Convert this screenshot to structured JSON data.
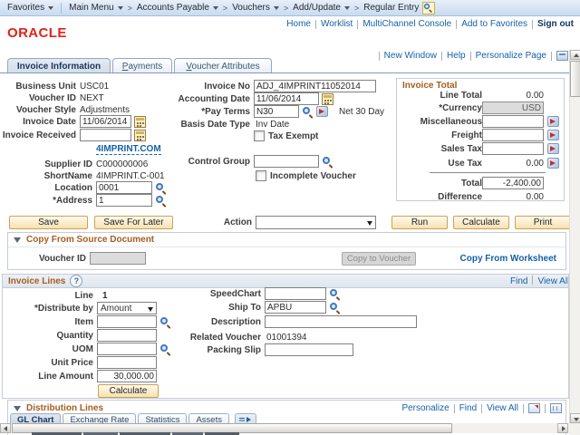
{
  "chrome": {
    "favorites": "Favorites",
    "main_menu": "Main Menu",
    "breadcrumbs": [
      "Accounts Payable",
      "Vouchers",
      "Add/Update",
      "Regular Entry"
    ],
    "nav_links": {
      "home": "Home",
      "worklist": "Worklist",
      "multichannel_console": "MultiChannel Console",
      "add_to_favorites": "Add to Favorites",
      "sign_out": "Sign out"
    },
    "logo": "ORACLE",
    "utility": {
      "new_window": "New Window",
      "help": "Help",
      "personalize_page": "Personalize Page"
    }
  },
  "page_tabs": {
    "invoice_information": "Invoice Information",
    "payments": "Payments",
    "voucher_attributes": "Voucher Attributes"
  },
  "header_fields": {
    "business_unit": {
      "label": "Business Unit",
      "value": "USC01"
    },
    "voucher_id": {
      "label": "Voucher ID",
      "value": "NEXT"
    },
    "voucher_style": {
      "label": "Voucher Style",
      "value": "Adjustments"
    },
    "invoice_date": {
      "label": "Invoice Date",
      "value": "11/06/2014"
    },
    "invoice_received": {
      "label": "Invoice Received",
      "value": ""
    },
    "supplier_site": "4IMPRINT.COM",
    "supplier_id": {
      "label": "Supplier ID",
      "value": "C000000006"
    },
    "short_name": {
      "label": "ShortName",
      "value": "4IMPRINT.C-001"
    },
    "location": {
      "label": "Location",
      "value": "0001"
    },
    "address": {
      "label": "*Address",
      "value": "1"
    },
    "invoice_no": {
      "label": "Invoice No",
      "value": "ADJ_4IMPRINT11052014"
    },
    "accounting_date": {
      "label": "Accounting Date",
      "value": "11/06/2014"
    },
    "pay_terms": {
      "label": "*Pay Terms",
      "value": "N30",
      "description": "Net 30 Day"
    },
    "basis_date_type": {
      "label": "Basis Date Type",
      "value": "Inv Date"
    },
    "tax_exempt_label": "Tax Exempt",
    "control_group": {
      "label": "Control Group",
      "value": ""
    },
    "incomplete_voucher_label": "Incomplete Voucher"
  },
  "invoice_total": {
    "title": "Invoice Total",
    "line_total": {
      "label": "Line Total",
      "value": "0.00"
    },
    "currency": {
      "label": "*Currency",
      "value": "USD"
    },
    "miscellaneous": {
      "label": "Miscellaneous",
      "value": ""
    },
    "freight": {
      "label": "Freight",
      "value": ""
    },
    "sales_tax": {
      "label": "Sales Tax",
      "value": ""
    },
    "use_tax": {
      "label": "Use Tax",
      "value": "0.00"
    },
    "total": {
      "label": "Total",
      "value": "-2,400.00"
    },
    "difference": {
      "label": "Difference",
      "value": "0.00"
    }
  },
  "toolbar": {
    "save": "Save",
    "save_for_later": "Save For Later",
    "action_label": "Action",
    "action_value": "",
    "run": "Run",
    "calculate": "Calculate",
    "print": "Print"
  },
  "copy_source": {
    "title": "Copy From Source Document",
    "voucher_id_label": "Voucher ID",
    "voucher_id_value": "",
    "copy_to_voucher": "Copy to Voucher",
    "copy_from_worksheet": "Copy From Worksheet"
  },
  "invoice_lines": {
    "title": "Invoice Lines",
    "find": "Find",
    "view_all": "View All",
    "line": {
      "label": "Line",
      "value": "1"
    },
    "distribute_by": {
      "label": "*Distribute by",
      "value": "Amount"
    },
    "item": {
      "label": "Item",
      "value": ""
    },
    "quantity": {
      "label": "Quantity",
      "value": ""
    },
    "uom": {
      "label": "UOM",
      "value": ""
    },
    "unit_price": {
      "label": "Unit Price",
      "value": ""
    },
    "line_amount": {
      "label": "Line Amount",
      "value": "30,000.00"
    },
    "calculate": "Calculate",
    "speedchart": {
      "label": "SpeedChart",
      "value": ""
    },
    "ship_to": {
      "label": "Ship To",
      "value": "APBU"
    },
    "description": {
      "label": "Description",
      "value": ""
    },
    "related_voucher": {
      "label": "Related Voucher",
      "value": "01001394"
    },
    "packing_slip": {
      "label": "Packing Slip",
      "value": ""
    }
  },
  "distribution_lines": {
    "title": "Distribution Lines",
    "personalize": "Personalize",
    "find": "Find",
    "view_all": "View All",
    "grid_tabs": [
      "GL Chart",
      "Exchange Rate",
      "Statistics",
      "Assets"
    ]
  },
  "colors": {
    "oracle_red": "#e2231a",
    "link_blue": "#1560a8",
    "section_orange": "#a55d20",
    "top_bar_blue": "#c8dbf0",
    "button_fill": "#f6e1ae"
  }
}
